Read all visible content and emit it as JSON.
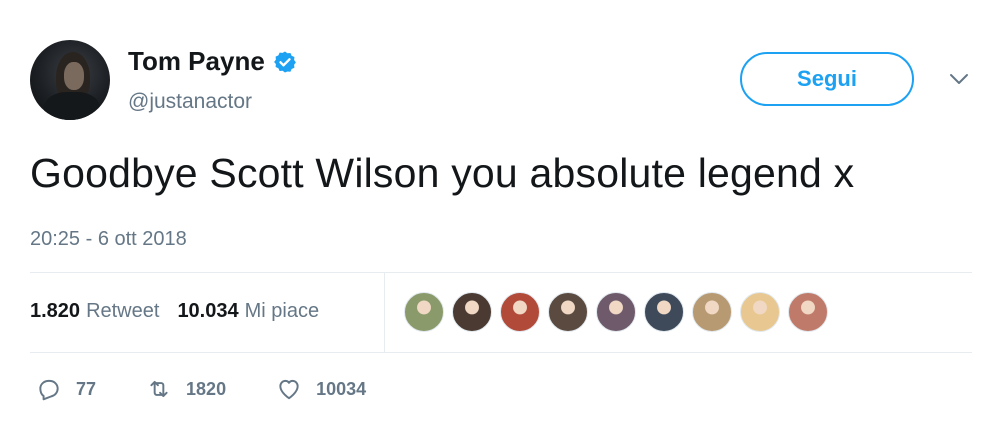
{
  "user": {
    "name": "Tom Payne",
    "handle": "@justanactor",
    "verified": true
  },
  "follow_button": {
    "label": "Segui"
  },
  "tweet": {
    "text": "Goodbye Scott Wilson you absolute legend x",
    "timestamp": "20:25 - 6 ott 2018"
  },
  "stats": {
    "retweets_count": "1.820",
    "retweets_label": "Retweet",
    "likes_count": "10.034",
    "likes_label": "Mi piace"
  },
  "likers": [
    {
      "color": "#8a9a6a"
    },
    {
      "color": "#4a3a32"
    },
    {
      "color": "#b24a3a"
    },
    {
      "color": "#5a4a40"
    },
    {
      "color": "#6e5a6a"
    },
    {
      "color": "#3e4a5a"
    },
    {
      "color": "#b89a72"
    },
    {
      "color": "#e8c890"
    },
    {
      "color": "#c07a6a"
    }
  ],
  "actions": {
    "replies": "77",
    "retweets": "1820",
    "likes": "10034"
  },
  "colors": {
    "accent": "#1da1f2",
    "secondary_text": "#657786",
    "divider": "#e6ecf0"
  }
}
